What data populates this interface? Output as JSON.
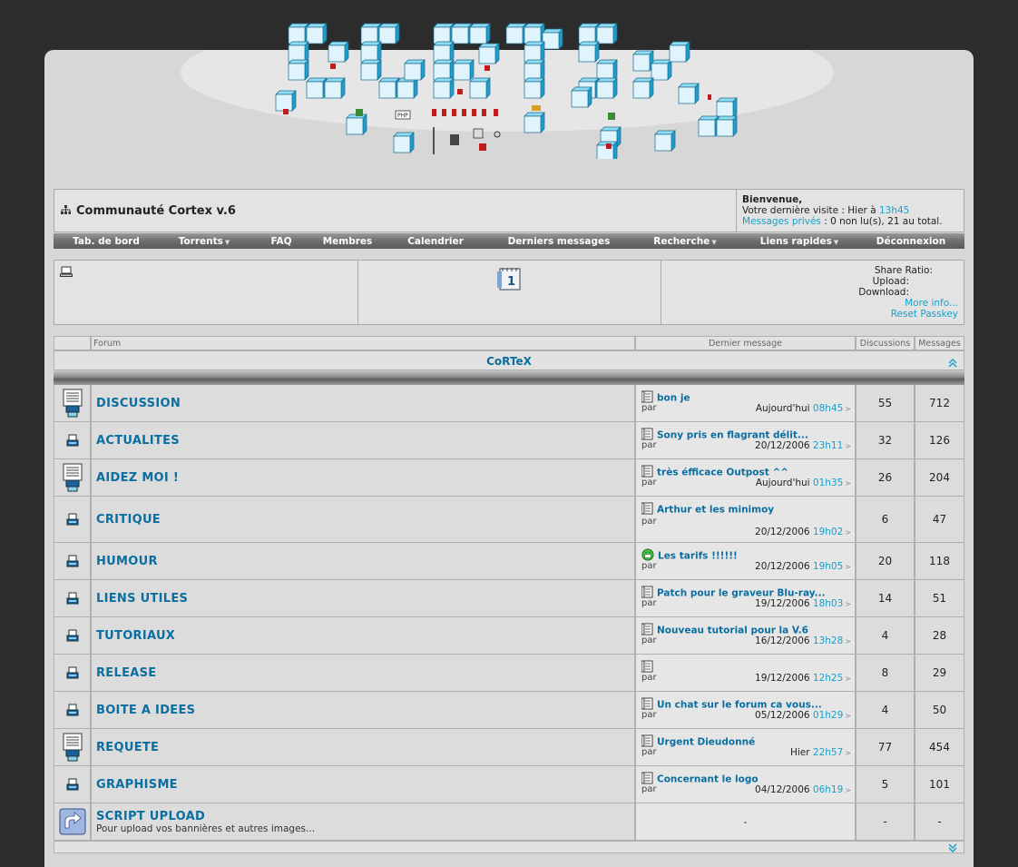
{
  "header": {
    "title": "Communauté Cortex v.6",
    "welcome": "Bienvenue,",
    "last_visit_label": "Votre dernière visite : Hier à ",
    "last_visit_time": "13h45",
    "pm_link": "Messages privés",
    "pm_text": " : 0 non lu(s), 21 au total."
  },
  "nav": [
    {
      "label": "Tab. de bord",
      "dropdown": false
    },
    {
      "label": "Torrents",
      "dropdown": true
    },
    {
      "label": "FAQ",
      "dropdown": false
    },
    {
      "label": "Membres",
      "dropdown": false
    },
    {
      "label": "Calendrier",
      "dropdown": false
    },
    {
      "label": "Derniers messages",
      "dropdown": false
    },
    {
      "label": "Recherche",
      "dropdown": true
    },
    {
      "label": "Liens rapides",
      "dropdown": true
    },
    {
      "label": "Déconnexion",
      "dropdown": false
    }
  ],
  "info": {
    "calendar_day": "1",
    "ratio_label": "Share Ratio:",
    "upload_label": "Upload:",
    "download_label": "Download:",
    "more_info": "More info...",
    "reset_passkey": "Reset Passkey"
  },
  "table": {
    "col_forum": "Forum",
    "col_last": "Dernier message",
    "col_disc": "Discussions",
    "col_msgs": "Messages",
    "category": "CoRTeX",
    "par": "par",
    "forums": [
      {
        "name": "DISCUSSION",
        "icon": "folder-new",
        "last_title": "bon je",
        "last_date": "Aujourd'hui",
        "last_time": "08h45",
        "disc": "55",
        "msgs": "712"
      },
      {
        "name": "ACTUALITES",
        "icon": "folder",
        "last_title": "Sony pris en flagrant délit...",
        "last_date": "20/12/2006",
        "last_time": "23h11",
        "disc": "32",
        "msgs": "126"
      },
      {
        "name": "AIDEZ MOI !",
        "icon": "folder-new",
        "last_title": "très éfficace Outpost ^^",
        "last_date": "Aujourd'hui",
        "last_time": "01h35",
        "disc": "26",
        "msgs": "204"
      },
      {
        "name": "CRITIQUE",
        "icon": "folder",
        "last_title": "Arthur et les minimoy",
        "last_date": "20/12/2006",
        "last_time": "19h02",
        "disc": "6",
        "msgs": "47"
      },
      {
        "name": "HUMOUR",
        "icon": "folder",
        "last_title": "Les tarifs !!!!!!",
        "last_date": "20/12/2006",
        "last_time": "19h05",
        "disc": "20",
        "msgs": "118",
        "smiley": true
      },
      {
        "name": "LIENS UTILES",
        "icon": "folder",
        "last_title": "Patch pour le graveur Blu-ray...",
        "last_date": "19/12/2006",
        "last_time": "18h03",
        "disc": "14",
        "msgs": "51"
      },
      {
        "name": "TUTORIAUX",
        "icon": "folder",
        "last_title": "Nouveau tutorial pour la V.6",
        "last_date": "16/12/2006",
        "last_time": "13h28",
        "disc": "4",
        "msgs": "28"
      },
      {
        "name": "RELEASE",
        "icon": "folder",
        "last_title": "",
        "last_date": "19/12/2006",
        "last_time": "12h25",
        "disc": "8",
        "msgs": "29"
      },
      {
        "name": "BOITE A IDEES",
        "icon": "folder",
        "last_title": "Un chat sur le forum ca vous...",
        "last_date": "05/12/2006",
        "last_time": "01h29",
        "disc": "4",
        "msgs": "50"
      },
      {
        "name": "REQUETE",
        "icon": "folder-new",
        "last_title": "Urgent Dieudonné",
        "last_date": "Hier",
        "last_time": "22h57",
        "disc": "77",
        "msgs": "454"
      },
      {
        "name": "GRAPHISME",
        "icon": "folder",
        "last_title": "Concernant le logo",
        "last_date": "04/12/2006",
        "last_time": "06h19",
        "disc": "5",
        "msgs": "101"
      },
      {
        "name": "SCRIPT UPLOAD",
        "icon": "link",
        "desc": "Pour upload vos bannières et autres images...",
        "last_title": "",
        "last_date": "",
        "last_time": "",
        "empty_last": "-",
        "disc": "-",
        "msgs": "-"
      }
    ]
  },
  "colors": {
    "link": "#0a6ea0",
    "time": "#19a0c8",
    "bg": "#2c2c2c"
  }
}
